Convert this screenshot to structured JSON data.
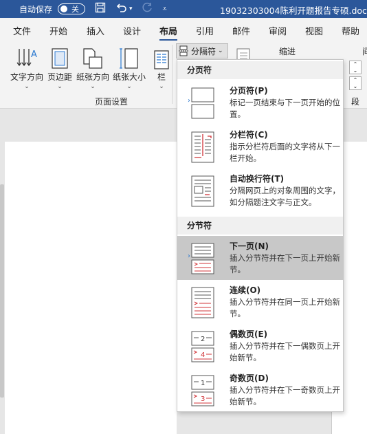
{
  "titlebar": {
    "autosave_label": "自动保存",
    "toggle_label": "关",
    "doc_title": "19032303004陈利开题报告专硕.doc -"
  },
  "tabs": [
    {
      "label": "文件"
    },
    {
      "label": "开始"
    },
    {
      "label": "插入"
    },
    {
      "label": "设计"
    },
    {
      "label": "布局"
    },
    {
      "label": "引用"
    },
    {
      "label": "邮件"
    },
    {
      "label": "审阅"
    },
    {
      "label": "视图"
    },
    {
      "label": "帮助"
    }
  ],
  "active_tab": "布局",
  "ribbon": {
    "buttons": [
      {
        "label": "文字方向"
      },
      {
        "label": "页边距"
      },
      {
        "label": "纸张方向"
      },
      {
        "label": "纸张大小"
      },
      {
        "label": "栏"
      }
    ],
    "breaks_button": "分隔符",
    "page_setup_group": "页面设置",
    "indent_label": "缩进",
    "right_label": "间",
    "paragraph_group": "段落"
  },
  "dropdown": {
    "page_breaks_header": "分页符",
    "section_breaks_header": "分节符",
    "items": [
      {
        "title": "分页符(P)",
        "desc": "标记一页结束与下一页开始的位置。"
      },
      {
        "title": "分栏符(C)",
        "desc": "指示分栏符后面的文字将从下一栏开始。"
      },
      {
        "title": "自动换行符(T)",
        "desc": "分隔网页上的对象周围的文字，如分隔题注文字与正文。"
      },
      {
        "title": "下一页(N)",
        "desc": "插入分节符并在下一页上开始新节。"
      },
      {
        "title": "连续(O)",
        "desc": "插入分节符并在同一页上开始新节。"
      },
      {
        "title": "偶数页(E)",
        "desc": "插入分节符并在下一偶数页上开始新节。"
      },
      {
        "title": "奇数页(D)",
        "desc": "插入分节符并在下一奇数页上开始新节。"
      }
    ]
  },
  "colors": {
    "titlebar": "#2b579a",
    "accent_red": "#d13438",
    "hover": "#c8c8c8"
  }
}
